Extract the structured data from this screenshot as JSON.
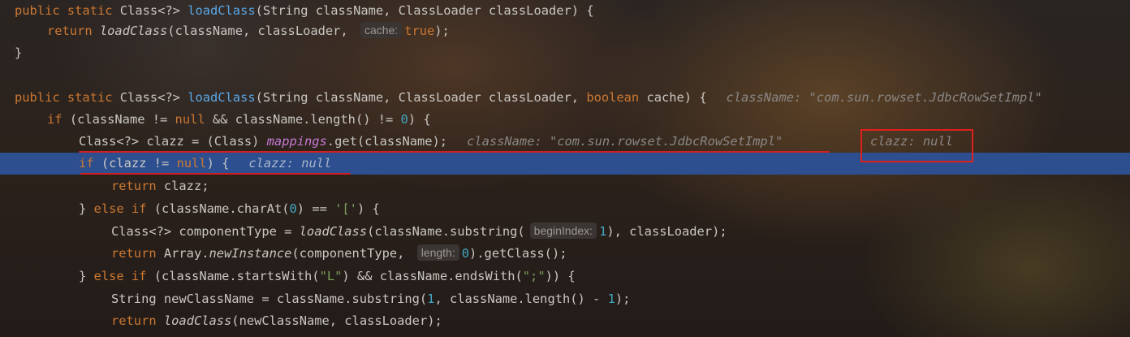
{
  "code": {
    "kw_public": "public",
    "kw_static": "static",
    "kw_return": "return",
    "kw_if": "if",
    "kw_else": "else",
    "kw_null": "null",
    "kw_true": "true",
    "kw_boolean": "boolean",
    "class_generic": "Class<?>",
    "load_class": "loadClass",
    "params_2": "(String className, ClassLoader classLoader) {",
    "params_3a": "(String className, ClassLoader classLoader, ",
    "params_3b": " cache) {",
    "args_return1": "(className, classLoader, ",
    "hint_cache": "cache:",
    "close_paren_semicolon": ");",
    "close_brace": "}",
    "if_cond_a": " (className != ",
    "if_cond_b": " && className.length() != ",
    "zero": "0",
    "if_cond_c": ") {",
    "decl_clazz": "Class<?> clazz = (Class) ",
    "mappings": "mappings",
    "get_call": ".get(className);",
    "if_clazz_a": " (clazz != ",
    "if_clazz_b": ") {",
    "return_clazz": " clazz;",
    "else_if_a": "} ",
    "charat_a": " (className.charAt(",
    "charat_b": ") == ",
    "bracket_str": "'['",
    "charat_c": ") {",
    "component_decl": "Class<?> componentType = ",
    "substring_open": "(className.substring(",
    "hint_begin": "beginIndex:",
    "one": "1",
    "substring_close": "), classLoader);",
    "return_array": " Array.",
    "new_instance": "newInstance",
    "component_args": "(componentType, ",
    "hint_length": "length:",
    "get_class": ").getClass();",
    "starts_a": " (className.startsWith(",
    "str_L": "\"L\"",
    "starts_b": ") && className.endsWith(",
    "str_semi": "\";\"",
    "starts_c": ")) {",
    "newname_decl": "String newClassName = className.substring(",
    "newname_mid": ", className.length() - ",
    "newname_end": ");",
    "return_load_args": "(newClassName, classLoader);"
  },
  "inline_values": {
    "class_name_value": "className: \"com.sun.rowset.JdbcRowSetImpl\"",
    "clazz_null": "clazz: null"
  }
}
